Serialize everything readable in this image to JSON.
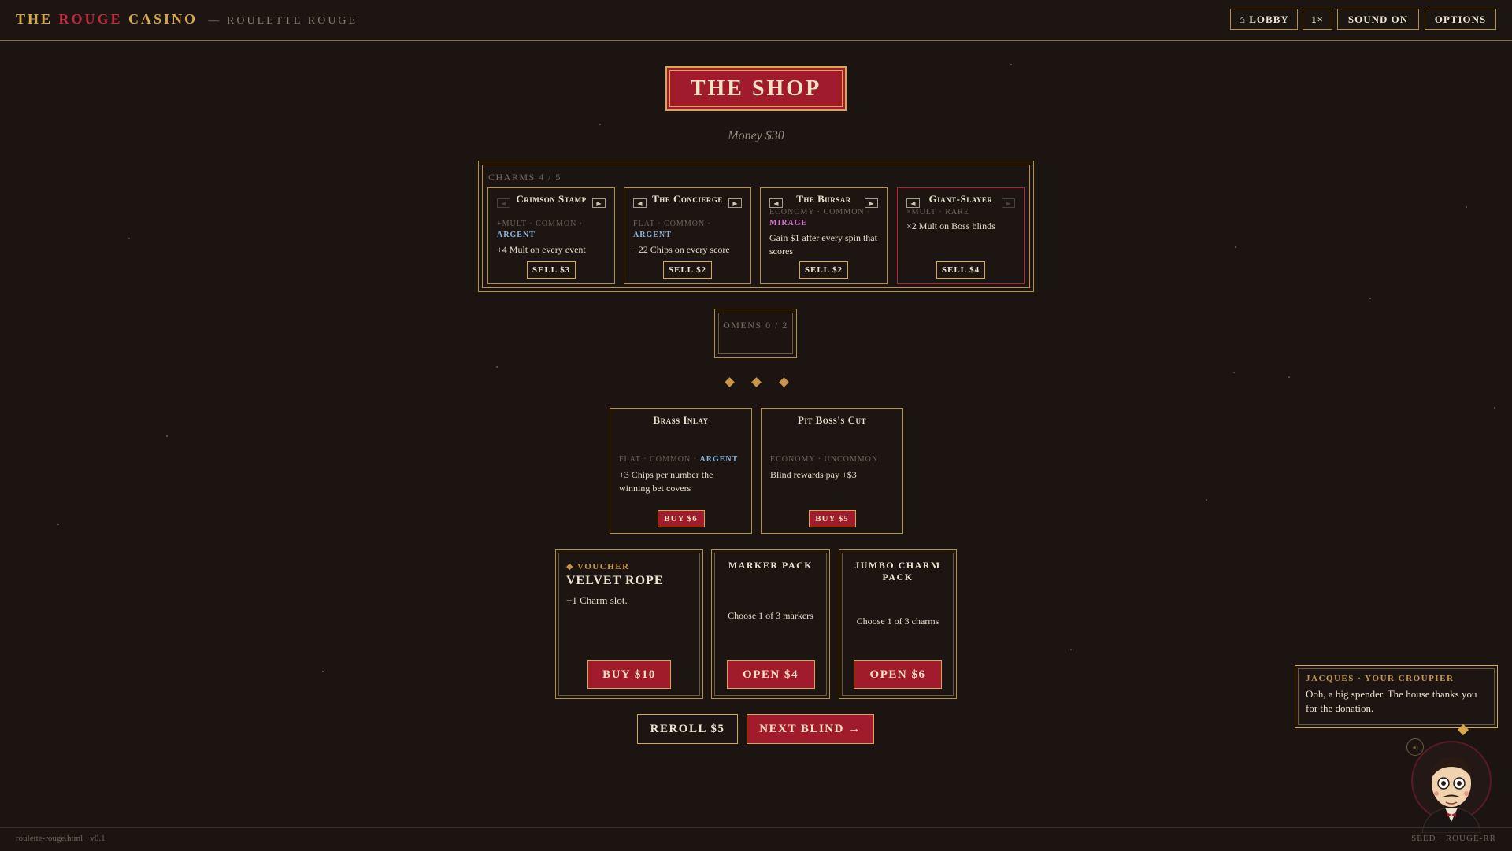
{
  "topbar": {
    "brand_the": "THE",
    "brand_rouge": "ROUGE",
    "brand_casino": "CASINO",
    "brand_sub": "— ROULETTE ROUGE",
    "lobby": "⌂ LOBBY",
    "speed": "1×",
    "sound": "SOUND ON",
    "options": "OPTIONS"
  },
  "shop": {
    "title": "THE SHOP",
    "money": "Money $30"
  },
  "charms": {
    "label": "CHARMS 4 / 5",
    "items": [
      {
        "name": "Crimson Stamp",
        "tags": "+MULT · COMMON ·",
        "edition": "ARGENT",
        "desc": "+4 Mult on every event",
        "sell": "SELL $3"
      },
      {
        "name": "The Concierge",
        "tags": "FLAT · COMMON ·",
        "edition": "ARGENT",
        "desc": "+22 Chips on every score",
        "sell": "SELL $2"
      },
      {
        "name": "The Bursar",
        "tags": "ECONOMY · COMMON ·",
        "edition": "MIRAGE",
        "desc": "Gain $1 after every spin that scores",
        "sell": "SELL $2"
      },
      {
        "name": "Giant-Slayer",
        "tags": "×MULT · RARE",
        "desc": "×2 Mult on Boss blinds",
        "sell": "SELL $4"
      }
    ]
  },
  "omens": {
    "label": "OMENS 0 / 2"
  },
  "items": [
    {
      "name": "Brass Inlay",
      "tags": "FLAT · COMMON ·",
      "edition": "ARGENT",
      "desc": "+3 Chips per number the winning bet covers",
      "buy": "BUY $6"
    },
    {
      "name": "Pit Boss's Cut",
      "tags": "ECONOMY · UNCOMMON",
      "desc": "Blind rewards pay +$3",
      "buy": "BUY $5"
    }
  ],
  "voucher": {
    "label": "◆ VOUCHER",
    "name": "VELVET ROPE",
    "desc": "+1 Charm slot.",
    "buy": "BUY $10"
  },
  "packs": [
    {
      "title": "MARKER PACK",
      "desc": "Choose 1 of 3 markers",
      "open": "OPEN $4"
    },
    {
      "title": "JUMBO CHARM PACK",
      "desc": "Choose 1 of 3 charms",
      "open": "OPEN $6"
    }
  ],
  "actions": {
    "reroll": "REROLL $5",
    "next_blind": "NEXT BLIND →"
  },
  "croupier": {
    "who": "JACQUES · YOUR CROUPIER",
    "message": "Ooh, a big spender. The house thanks you for the donation.",
    "mute_icon": "speaker-icon"
  },
  "footer": {
    "left": "roulette-rouge.html · v0.1",
    "right": "SEED · ROUGE-RR"
  },
  "colors": {
    "accent_red": "#a01c2c",
    "gold": "#d8a94a",
    "argent": "#8cb4dc",
    "mirage": "#d070c8"
  }
}
